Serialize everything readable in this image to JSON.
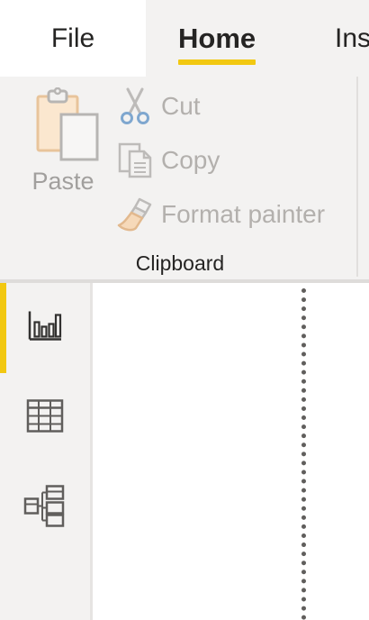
{
  "ribbon_tabs": {
    "file": "File",
    "home": "Home",
    "insert": "Ins"
  },
  "clipboard": {
    "paste_label": "Paste",
    "cut_label": "Cut",
    "copy_label": "Copy",
    "format_painter_label": "Format painter",
    "group_label": "Clipboard"
  },
  "icons": {
    "paste": "clipboard-paste-icon",
    "cut": "scissors-icon",
    "copy": "copy-icon",
    "format_painter": "paintbrush-icon",
    "report_view": "bar-chart-icon",
    "data_view": "table-grid-icon",
    "model_view": "model-diagram-icon"
  },
  "view_rail": {
    "active": "report-view"
  },
  "colors": {
    "accent": "#f2c811",
    "ribbon_bg": "#f3f2f1",
    "disabled_text": "#b3b0ad",
    "text": "#252423",
    "canvas": "#ffffff"
  }
}
